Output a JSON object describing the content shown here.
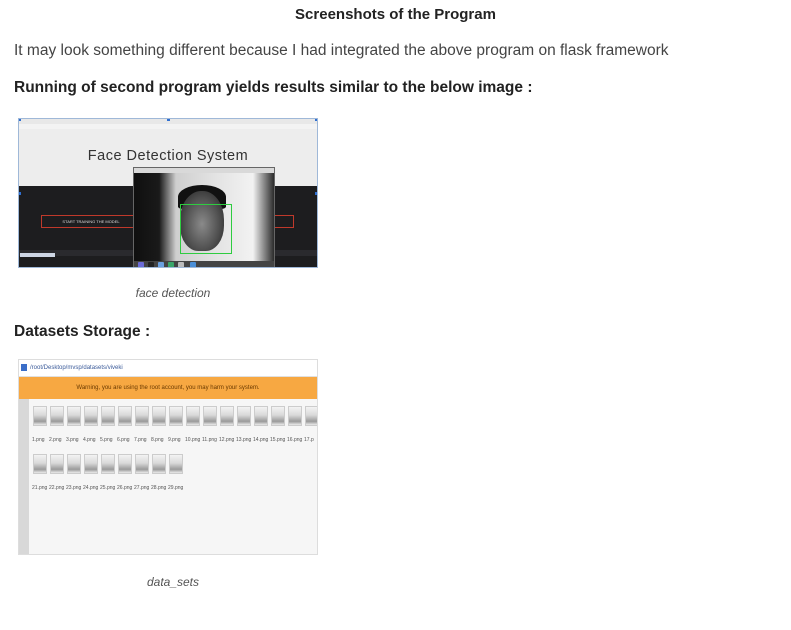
{
  "heading": "Screenshots of the Program",
  "intro": "It may look something different because I had integrated the above program on flask framework",
  "section1": {
    "title": "Running of second program yields results similar to the below image :",
    "screenshot": {
      "page_heading": "Face Detection System",
      "button_label": "START TRAINING THE MODEL"
    },
    "caption": "face detection"
  },
  "section2": {
    "title": "Datasets Storage :",
    "screenshot": {
      "path": "/root/Desktop/mvsp/datasets/viveki",
      "warning": "Warning, you are using the root account, you may harm your system.",
      "files_row1": [
        "1.png",
        "2.png",
        "3.png",
        "4.png",
        "5.png",
        "6.png",
        "7.png",
        "8.png",
        "9.png",
        "10.png",
        "11.png",
        "12.png",
        "13.png",
        "14.png",
        "15.png",
        "16.png",
        "17.p"
      ],
      "files_row2": [
        "21.png",
        "22.png",
        "23.png",
        "24.png",
        "25.png",
        "26.png",
        "27.png",
        "28.png",
        "29.png"
      ]
    },
    "caption": "data_sets"
  }
}
